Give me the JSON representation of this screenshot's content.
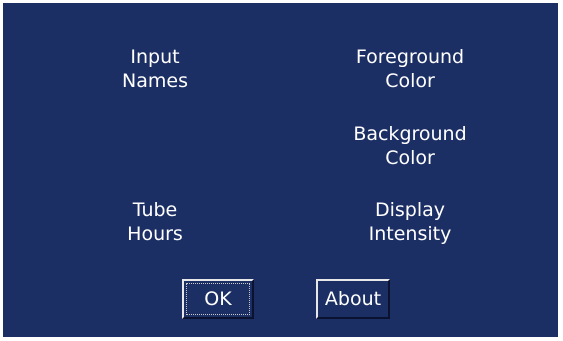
{
  "menu": {
    "input_names": [
      "Input",
      "Names"
    ],
    "foreground_color": [
      "Foreground",
      "Color"
    ],
    "background_color": [
      "Background",
      "Color"
    ],
    "tube_hours": [
      "Tube",
      "Hours"
    ],
    "display_intensity": [
      "Display",
      "Intensity"
    ]
  },
  "buttons": {
    "ok_label": "OK",
    "about_label": "About"
  },
  "colors": {
    "panel_background": "#1c2f64",
    "text": "#ffffff"
  }
}
